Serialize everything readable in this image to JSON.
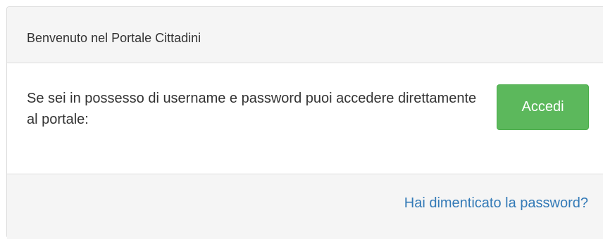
{
  "panel": {
    "heading": "Benvenuto nel Portale Cittadini",
    "body_text": "Se sei in possesso di username e password puoi accedere direttamente al portale:",
    "login_button_label": "Accedi",
    "forgot_password_link": "Hai dimenticato la password?"
  },
  "colors": {
    "primary_button": "#5cb85c",
    "link": "#337ab7",
    "panel_background": "#f5f5f5",
    "border": "#dddddd"
  }
}
